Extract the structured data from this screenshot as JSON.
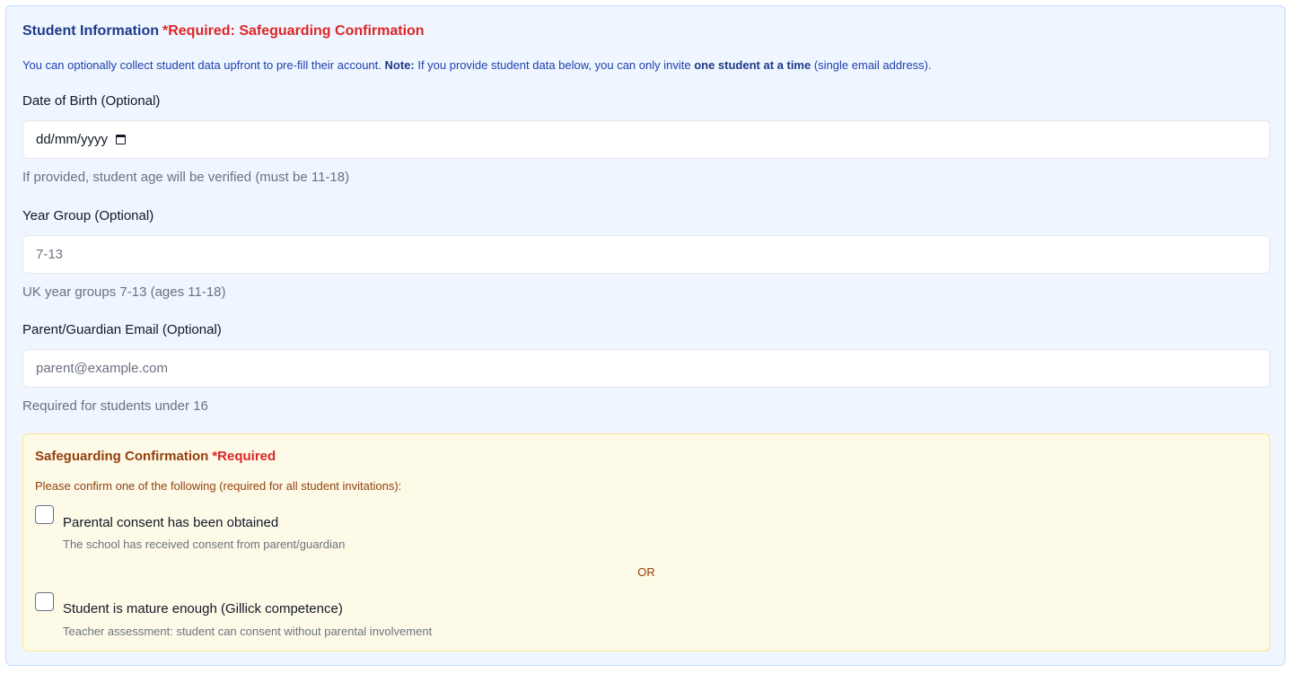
{
  "section": {
    "title": "Student Information",
    "required_badge": "*Required: Safeguarding Confirmation",
    "intro_before": "You can optionally collect student data upfront to pre-fill their account. ",
    "intro_note_label": "Note:",
    "intro_middle": " If you provide student data below, you can only invite ",
    "intro_emphasis": "one student at a time",
    "intro_after": " (single email address)."
  },
  "dob": {
    "label": "Date of Birth (Optional)",
    "value": "dd/mm/yyyy",
    "icon": "calendar-icon",
    "hint": "If provided, student age will be verified (must be 11-18)"
  },
  "year_group": {
    "label": "Year Group (Optional)",
    "placeholder": "7-13",
    "hint": "UK year groups 7-13 (ages 11-18)"
  },
  "parent_email": {
    "label": "Parent/Guardian Email (Optional)",
    "placeholder": "parent@example.com",
    "hint": "Required for students under 16"
  },
  "safeguarding": {
    "title": "Safeguarding Confirmation",
    "required_badge": "*Required",
    "intro": "Please confirm one of the following (required for all student invitations):",
    "option_parental": {
      "label": "Parental consent has been obtained",
      "description": "The school has received consent from parent/guardian",
      "checked": false
    },
    "separator": "OR",
    "option_gillick": {
      "label": "Student is mature enough (Gillick competence)",
      "description": "Teacher assessment: student can consent without parental involvement",
      "checked": false
    }
  },
  "colors": {
    "panel_bg": "#eff6ff",
    "title": "#1e3a8a",
    "required": "#dc2626",
    "safeguarding_bg": "#fefae8",
    "safeguarding_text": "#92400e"
  }
}
